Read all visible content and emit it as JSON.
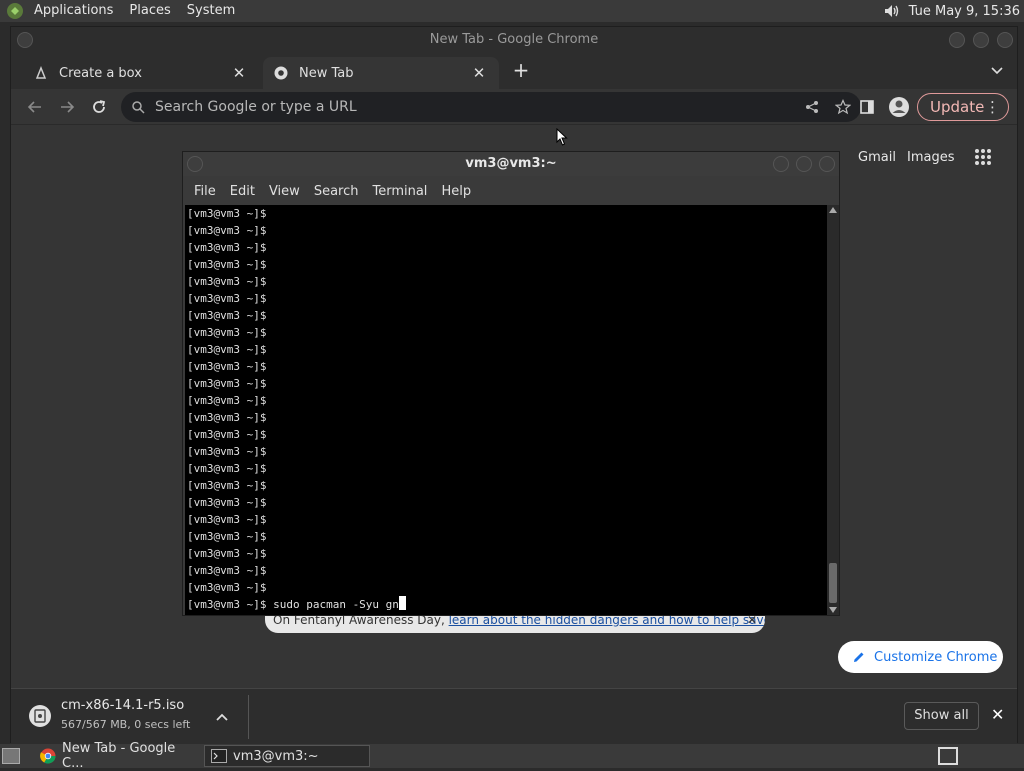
{
  "top_panel": {
    "menus": [
      "Applications",
      "Places",
      "System"
    ],
    "clock": "Tue May  9, 15:36"
  },
  "chrome": {
    "window_title": "New Tab - Google Chrome",
    "tabs": [
      {
        "label": "Create a box"
      },
      {
        "label": "New Tab"
      }
    ],
    "omnibox_placeholder": "Search Google or type a URL",
    "update_label": "Update",
    "ntp": {
      "gmail": "Gmail",
      "images": "Images",
      "notice_prefix": "On Fentanyl Awareness Day, ",
      "notice_link": "learn about the hidden dangers and how to help save lives",
      "customize_label": "Customize Chrome"
    },
    "download": {
      "filename": "cm-x86-14.1-r5.iso",
      "status": "567/567 MB, 0 secs left",
      "show_all": "Show all"
    }
  },
  "terminal": {
    "title": "vm3@vm3:~",
    "menu": [
      "File",
      "Edit",
      "View",
      "Search",
      "Terminal",
      "Help"
    ],
    "lines": [
      "[vm3@vm3 ~]$ ",
      "[vm3@vm3 ~]$ ",
      "[vm3@vm3 ~]$ ",
      "[vm3@vm3 ~]$ ",
      "[vm3@vm3 ~]$ ",
      "[vm3@vm3 ~]$ ",
      "[vm3@vm3 ~]$ ",
      "[vm3@vm3 ~]$ ",
      "[vm3@vm3 ~]$ ",
      "[vm3@vm3 ~]$ ",
      "[vm3@vm3 ~]$ ",
      "[vm3@vm3 ~]$ ",
      "[vm3@vm3 ~]$ ",
      "[vm3@vm3 ~]$ ",
      "[vm3@vm3 ~]$ ",
      "[vm3@vm3 ~]$ ",
      "[vm3@vm3 ~]$ ",
      "[vm3@vm3 ~]$ ",
      "[vm3@vm3 ~]$ ",
      "[vm3@vm3 ~]$ ",
      "[vm3@vm3 ~]$ ",
      "[vm3@vm3 ~]$ ",
      "[vm3@vm3 ~]$ "
    ],
    "current_line": "[vm3@vm3 ~]$ sudo pacman -Syu gn"
  },
  "taskbar": {
    "tasks": [
      {
        "label": "New Tab - Google C..."
      },
      {
        "label": "vm3@vm3:~"
      }
    ]
  },
  "colors": {
    "accent": "#1a73e8",
    "update_border": "#e09a9a"
  }
}
